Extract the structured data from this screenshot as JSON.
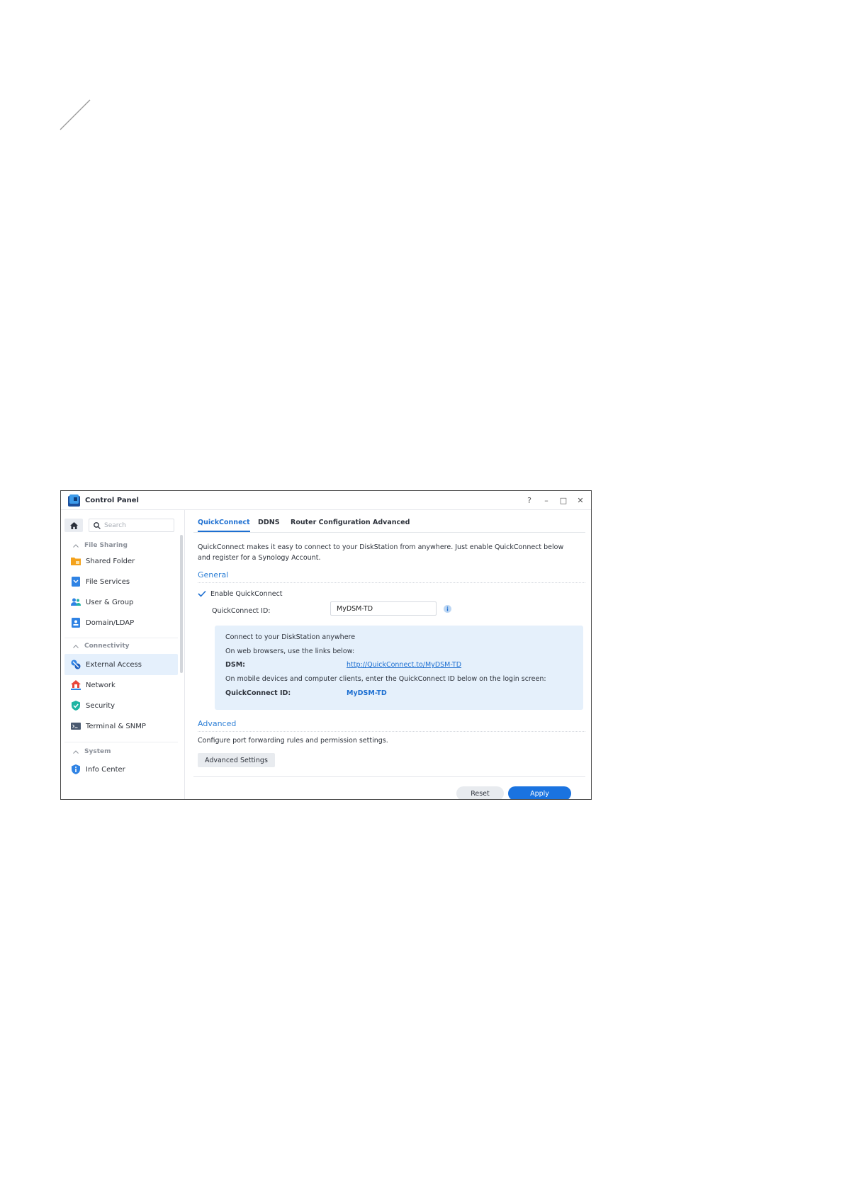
{
  "window": {
    "title": "Control Panel",
    "controls": {
      "help": "?",
      "minimize": "–",
      "maximize": "□",
      "close": "✕"
    }
  },
  "sidebar": {
    "search_placeholder": "Search",
    "sections": [
      {
        "label": "File Sharing",
        "items": [
          "Shared Folder",
          "File Services",
          "User & Group",
          "Domain/LDAP"
        ]
      },
      {
        "label": "Connectivity",
        "items": [
          "External Access",
          "Network",
          "Security",
          "Terminal & SNMP"
        ]
      },
      {
        "label": "System",
        "items": [
          "Info Center"
        ]
      }
    ],
    "active_item": "External Access"
  },
  "tabs": [
    "QuickConnect",
    "DDNS",
    "Router Configuration",
    "Advanced"
  ],
  "active_tab": "QuickConnect",
  "content": {
    "description_line1": "QuickConnect makes it easy to connect to your DiskStation from anywhere. Just enable QuickConnect below",
    "description_line2": "and register for a Synology Account.",
    "general_heading": "General",
    "enable_label": "Enable QuickConnect",
    "enable_checked": true,
    "id_label": "QuickConnect ID:",
    "id_value": "MyDSM-TD",
    "info": {
      "line1": "Connect to your DiskStation anywhere",
      "line2": "On web browsers, use the links below:",
      "dsm_label": "DSM:",
      "dsm_link": "http://QuickConnect.to/MyDSM-TD",
      "line3": "On mobile devices and computer clients, enter the QuickConnect ID below on the login screen:",
      "id_label": "QuickConnect ID:",
      "id_value": "MyDSM-TD"
    },
    "advanced_heading": "Advanced",
    "advanced_desc": "Configure port forwarding rules and permission settings.",
    "advanced_button": "Advanced Settings"
  },
  "footer": {
    "reset": "Reset",
    "apply": "Apply"
  },
  "colors": {
    "accent": "#1a73e0",
    "link": "#1d6fd1",
    "info_bg": "#e5f0fb",
    "active_item_bg": "#e5f0fc"
  }
}
